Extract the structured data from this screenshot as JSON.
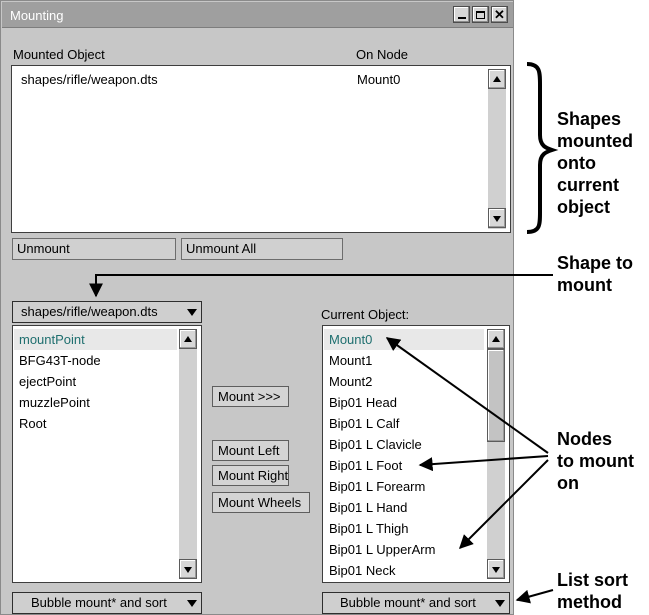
{
  "window": {
    "title": "Mounting"
  },
  "mounted": {
    "col_object": "Mounted Object",
    "col_node": "On Node",
    "rows": [
      {
        "object": "shapes/rifle/weapon.dts",
        "node": "Mount0"
      }
    ],
    "unmount_label": "Unmount",
    "unmount_all_label": "Unmount All"
  },
  "source": {
    "shape_selected": "shapes/rifle/weapon.dts",
    "nodes": [
      "mountPoint",
      "BFG43T-node",
      "ejectPoint",
      "muzzlePoint",
      "Root"
    ],
    "selected_index": 0,
    "sort_method": "Bubble mount* and sort"
  },
  "actions": {
    "mount": "Mount >>>",
    "mount_left": "Mount Left",
    "mount_right": "Mount Right",
    "mount_wheels": "Mount Wheels"
  },
  "target": {
    "label": "Current Object:",
    "nodes": [
      "Mount0",
      "Mount1",
      "Mount2",
      "Bip01 Head",
      "Bip01 L Calf",
      "Bip01 L Clavicle",
      "Bip01 L Foot",
      "Bip01 L Forearm",
      "Bip01 L Hand",
      "Bip01 L Thigh",
      "Bip01 L UpperArm",
      "Bip01 Neck"
    ],
    "selected_index": 0,
    "sort_method": "Bubble mount* and sort"
  },
  "annotations": {
    "mounted_shapes": [
      "Shapes",
      "mounted",
      "onto",
      "current",
      "object"
    ],
    "shape_to_mount": [
      "Shape to",
      "mount"
    ],
    "nodes_to_mount": [
      "Nodes",
      "to mount",
      "on"
    ],
    "list_sort": [
      "List sort",
      "method"
    ]
  }
}
